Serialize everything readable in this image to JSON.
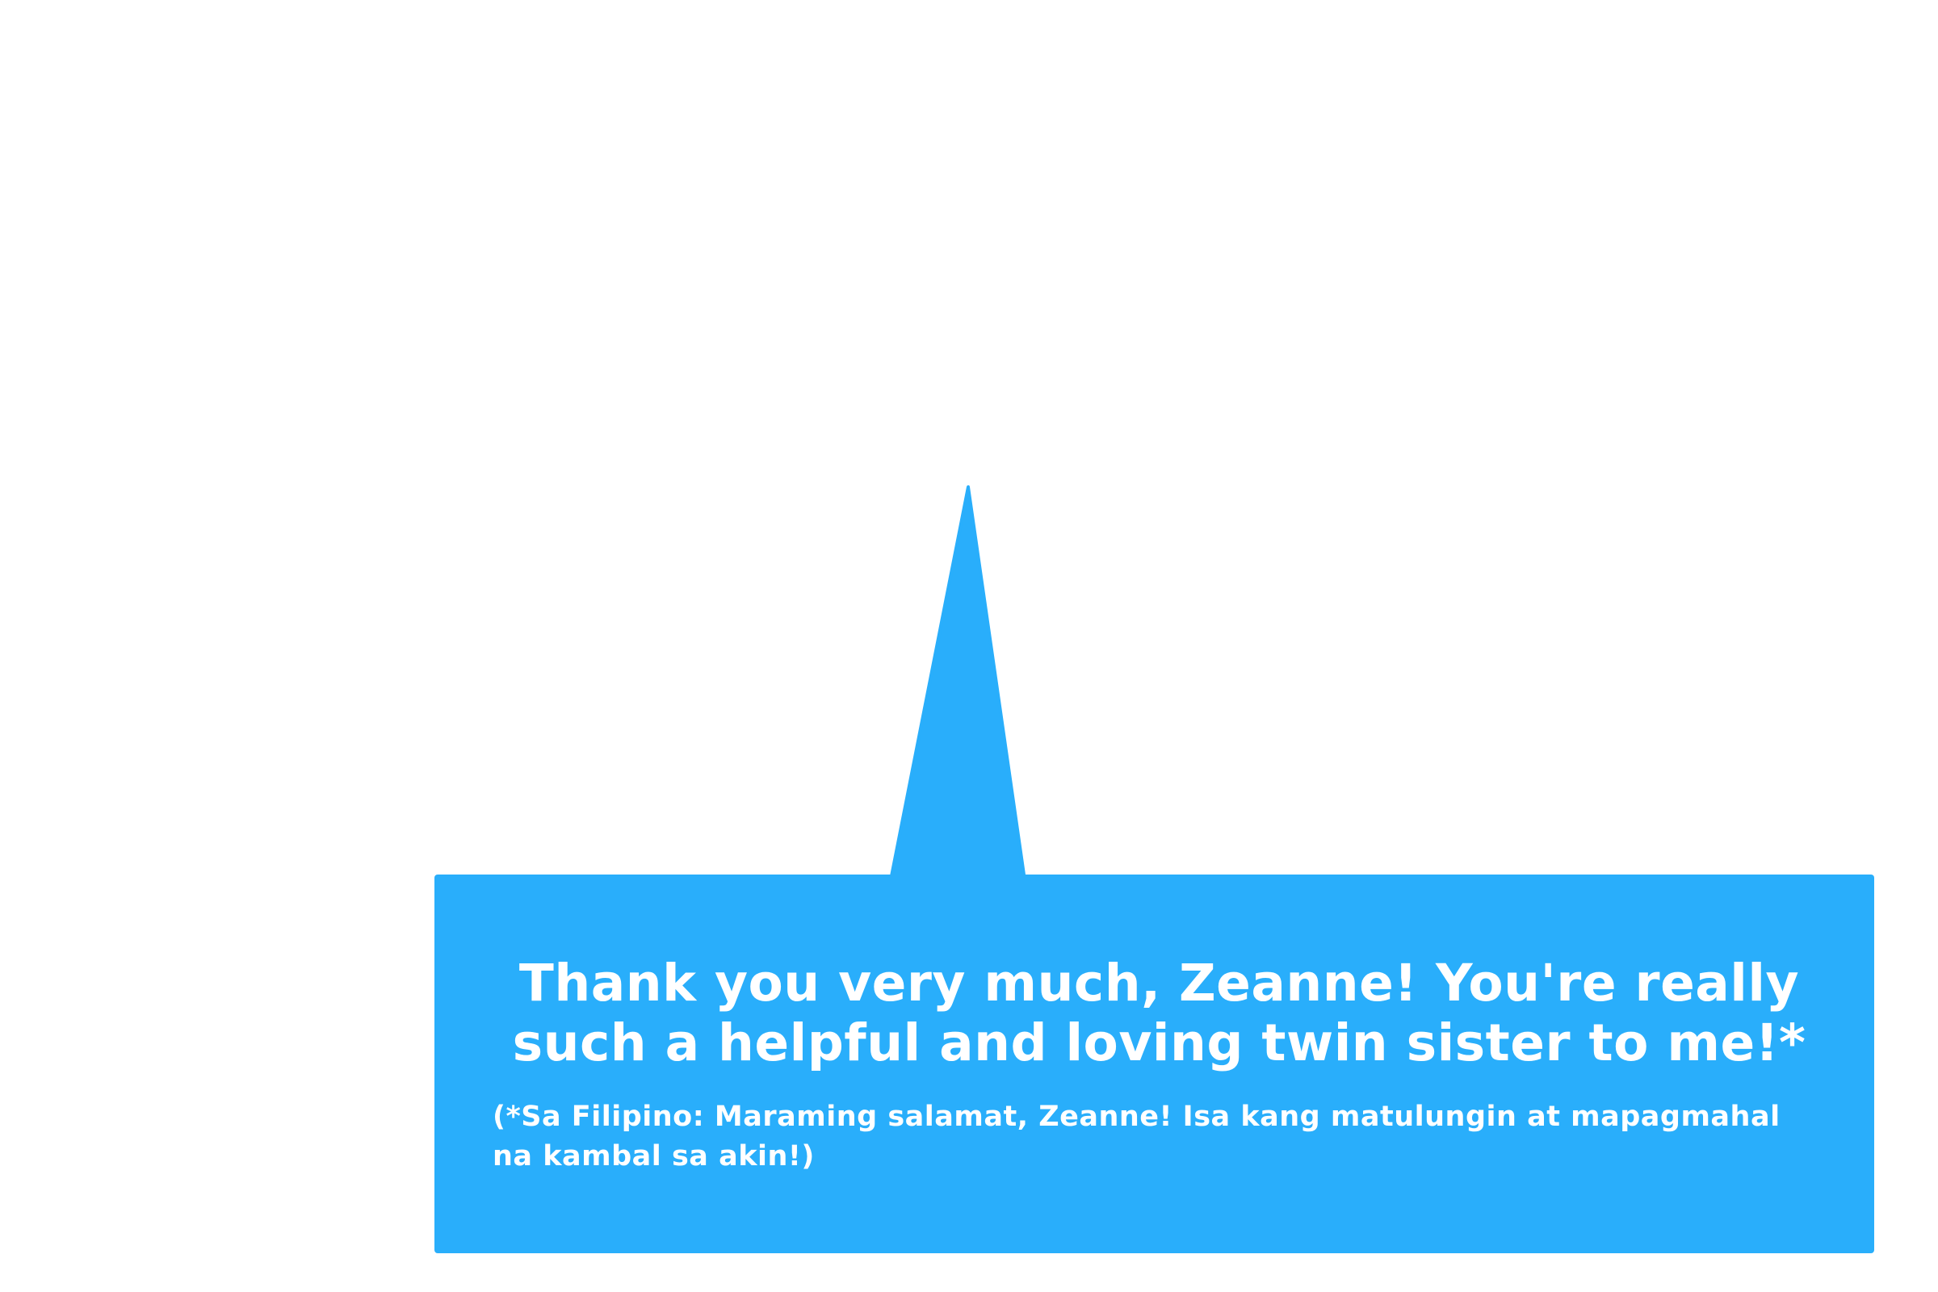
{
  "bubble": {
    "color": "#29aefb",
    "text_color": "#ffffff",
    "main_text": "Thank you very much, Zeanne! You're really\nsuch a helpful and loving twin sister to me!*",
    "note_text": "(*Sa Filipino: Maraming salamat, Zeanne! Isa kang matulungin at mapagmahal\nna kambal sa akin!)"
  }
}
